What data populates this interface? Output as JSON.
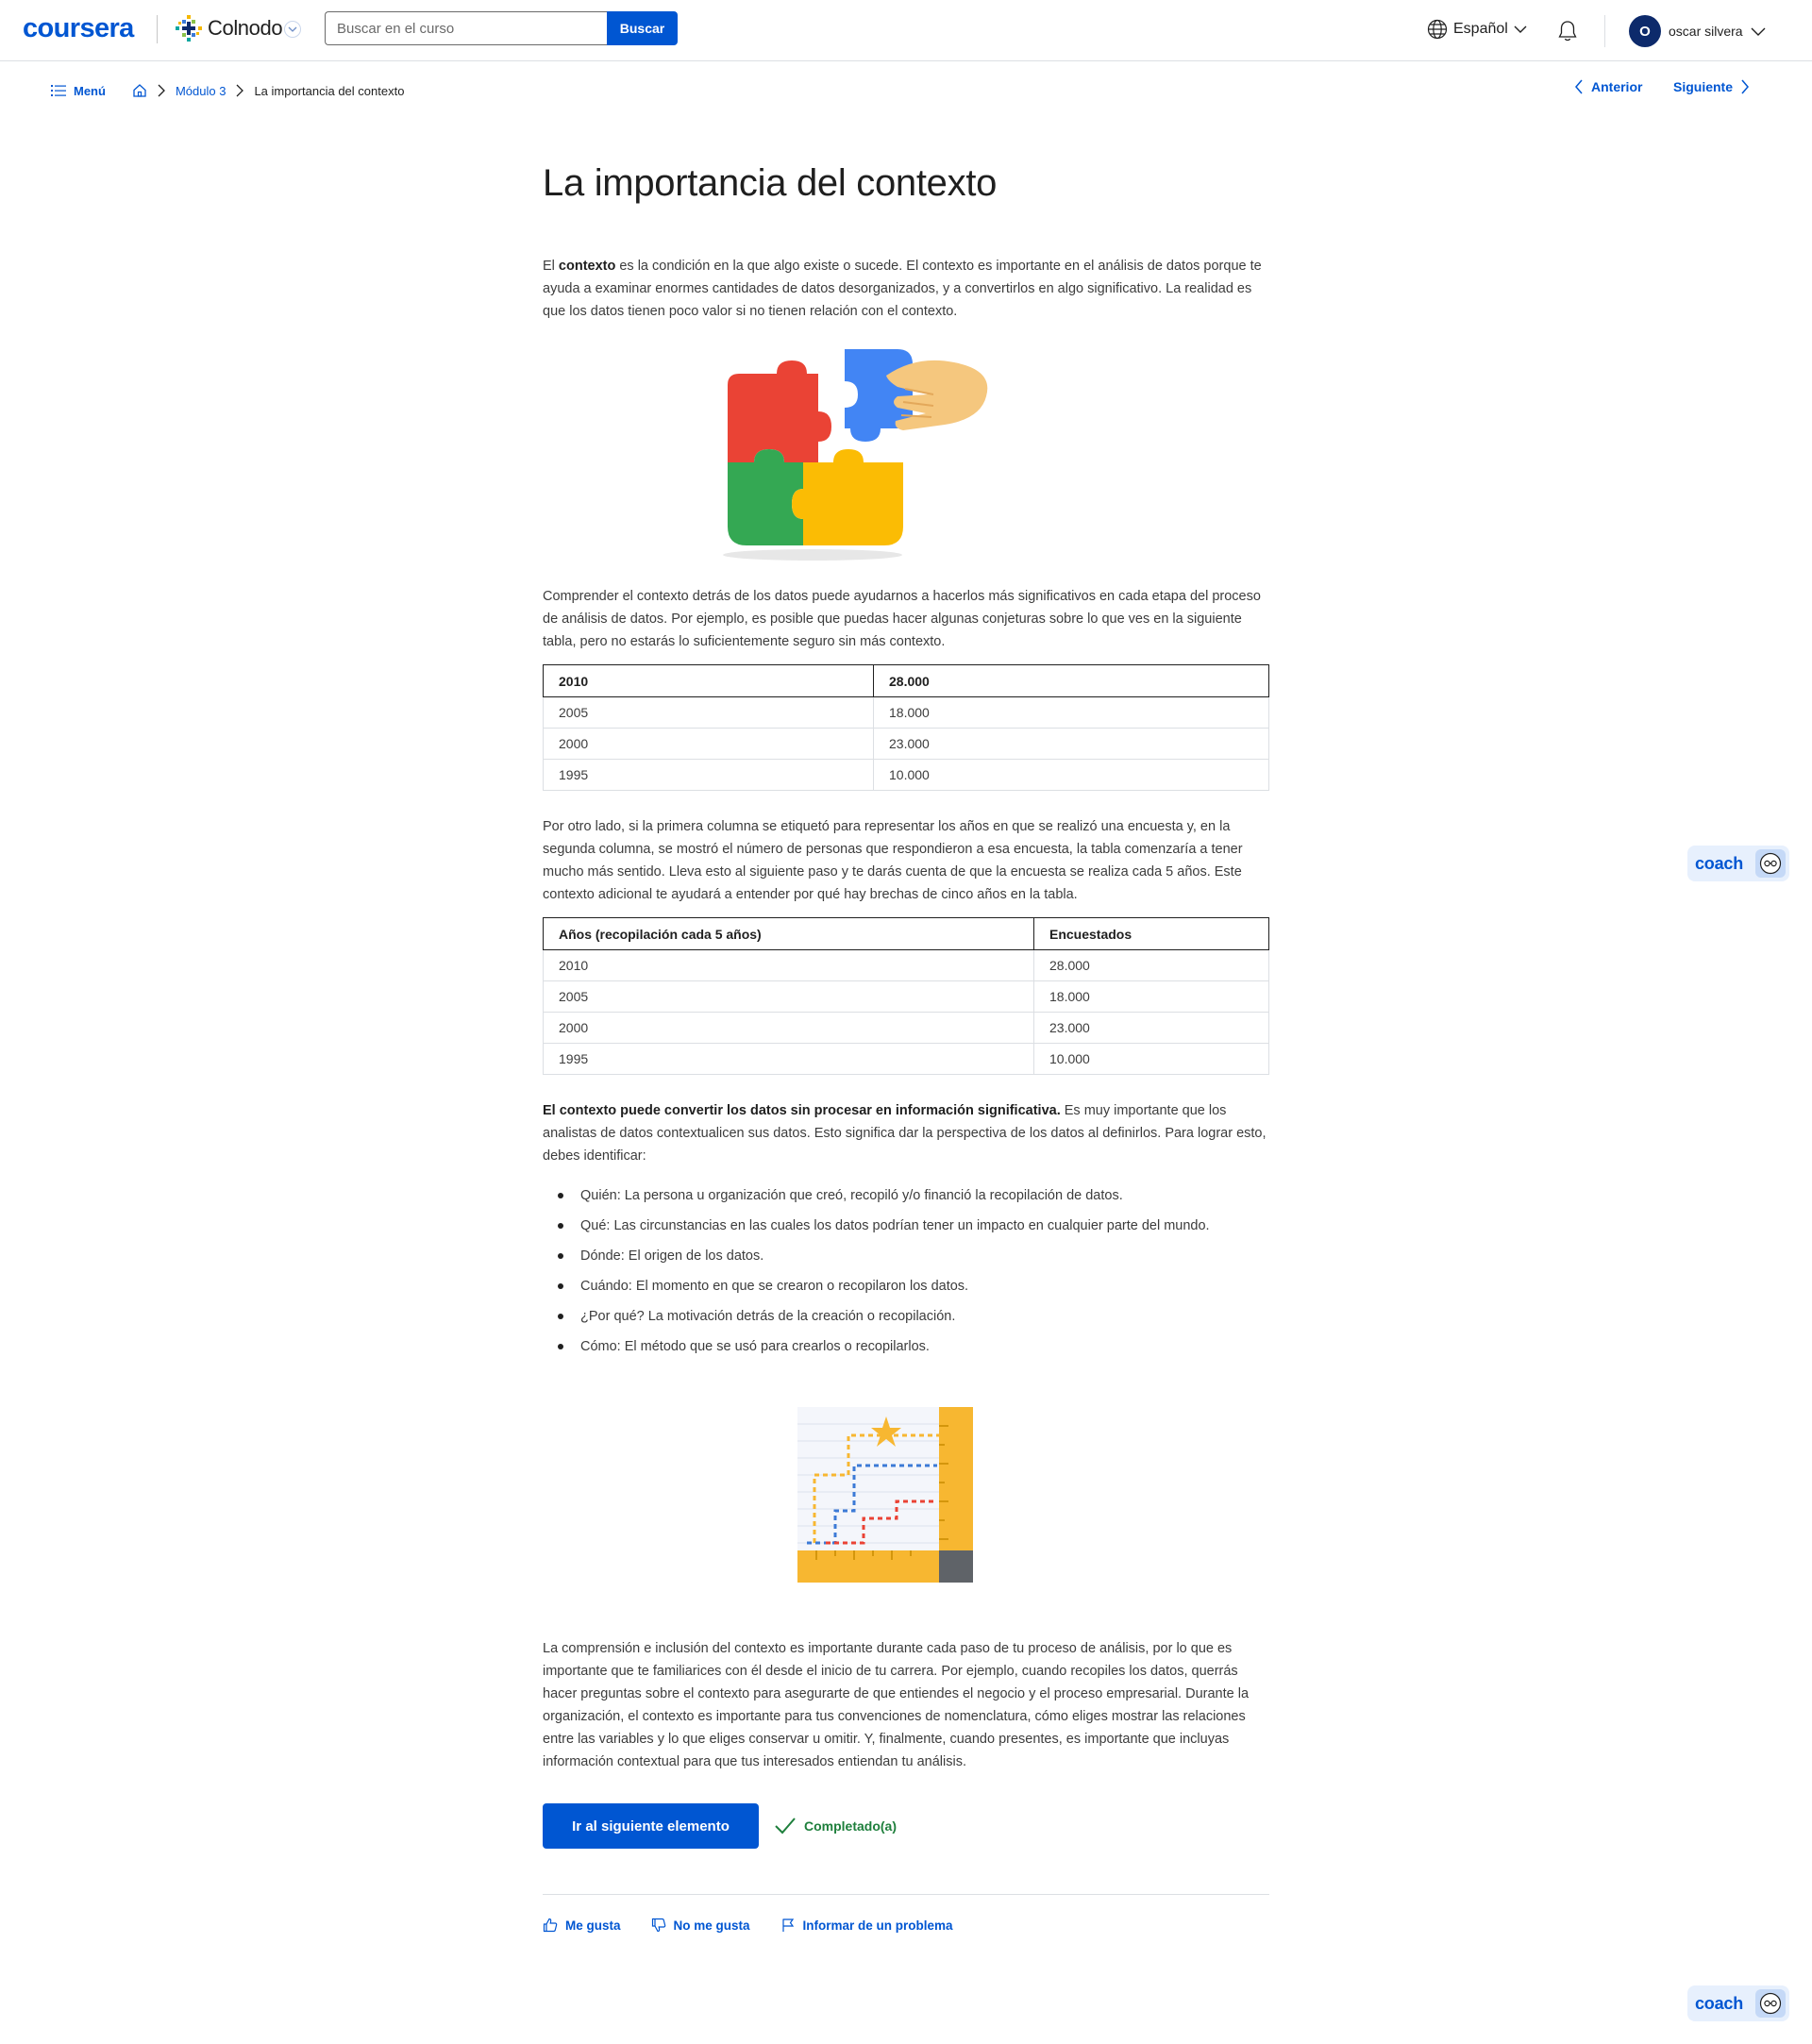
{
  "header": {
    "logo": "coursera",
    "partner_name": "Colnodo",
    "search": {
      "placeholder": "Buscar en el curso",
      "button": "Buscar"
    },
    "language": "Español",
    "user": {
      "initial": "O",
      "name": "oscar silvera"
    }
  },
  "breadcrumb": {
    "menu_label": "Menú",
    "module": "Módulo 3",
    "current": "La importancia del contexto"
  },
  "pager": {
    "previous": "Anterior",
    "next": "Siguiente"
  },
  "article": {
    "title": "La importancia del contexto",
    "intro": {
      "term": "contexto",
      "before": "El ",
      "after": " es la condición en la que algo existe o sucede. El contexto es importante en el análisis de datos porque te ayuda a examinar enormes cantidades de datos desorganizados, y a convertirlos en algo significativo. La realidad es que los datos tienen poco valor si no tienen relación con el contexto."
    },
    "paragraph_2": "Comprender el contexto detrás de los datos puede ayudarnos a hacerlos más significativos en cada etapa del proceso de análisis de datos. Por ejemplo, es posible que puedas hacer algunas conjeturas sobre lo que ves en la siguiente tabla, pero no estarás lo suficientemente seguro sin más contexto.",
    "table_1": {
      "headers": [
        "2010",
        "28.000"
      ],
      "rows": [
        [
          "2005",
          "18.000"
        ],
        [
          "2000",
          "23.000"
        ],
        [
          "1995",
          "10.000"
        ]
      ]
    },
    "paragraph_3": "Por otro lado, si la primera columna se etiquetó para representar los años en que se realizó una encuesta y, en la segunda columna, se mostró el número de personas que respondieron a esa encuesta, la tabla comenzaría a tener mucho más sentido. Lleva esto al siguiente paso y te darás cuenta de que la encuesta se realiza cada 5 años. Este contexto adicional te ayudará a entender por qué hay brechas de cinco años en la tabla.",
    "table_2": {
      "headers": [
        "Años (recopilación cada 5 años)",
        "Encuestados"
      ],
      "rows": [
        [
          "2010",
          "28.000"
        ],
        [
          "2005",
          "18.000"
        ],
        [
          "2000",
          "23.000"
        ],
        [
          "1995",
          "10.000"
        ]
      ]
    },
    "paragraph_4": {
      "bold": "El contexto puede convertir los datos sin procesar en información significativa.",
      "rest": " Es muy importante que los analistas de datos contextualicen sus datos. Esto significa dar la perspectiva de los datos al definirlos. Para lograr esto, debes identificar:"
    },
    "points": [
      "Quién: La persona u organización que creó, recopiló y/o financió la recopilación de datos.",
      "Qué: Las circunstancias en las cuales los datos podrían tener un impacto en cualquier parte del mundo.",
      "Dónde: El origen de los datos.",
      "Cuándo: El momento en que se crearon o recopilaron los datos.",
      "¿Por qué? La motivación detrás de la creación o recopilación.",
      "Cómo: El método que se usó para crearlos o recopilarlos."
    ],
    "paragraph_5": "La comprensión e inclusión del contexto es importante durante cada paso de tu proceso de análisis, por lo que es importante que te familiarices con él desde el inicio de tu carrera. Por ejemplo, cuando recopiles los datos, querrás hacer preguntas sobre el contexto para asegurarte de que entiendes el negocio y el proceso empresarial. Durante la organización, el contexto es importante para tus convenciones de nomenclatura, cómo eliges mostrar las relaciones entre las variables y lo que eliges conservar u omitir. Y, finalmente, cuando presentes, es importante que incluyas información contextual para que tus interesados entiendan tu análisis."
  },
  "actions": {
    "next_button": "Ir al siguiente elemento",
    "completed": "Completado(a)"
  },
  "feedback": {
    "like": "Me gusta",
    "dislike": "No me gusta",
    "report": "Informar de un problema"
  },
  "coach": {
    "label": "coach"
  },
  "colors": {
    "brand_blue": "#0056d2",
    "success_green": "#1e7f3c",
    "coach_bg": "#e7f0fd"
  }
}
